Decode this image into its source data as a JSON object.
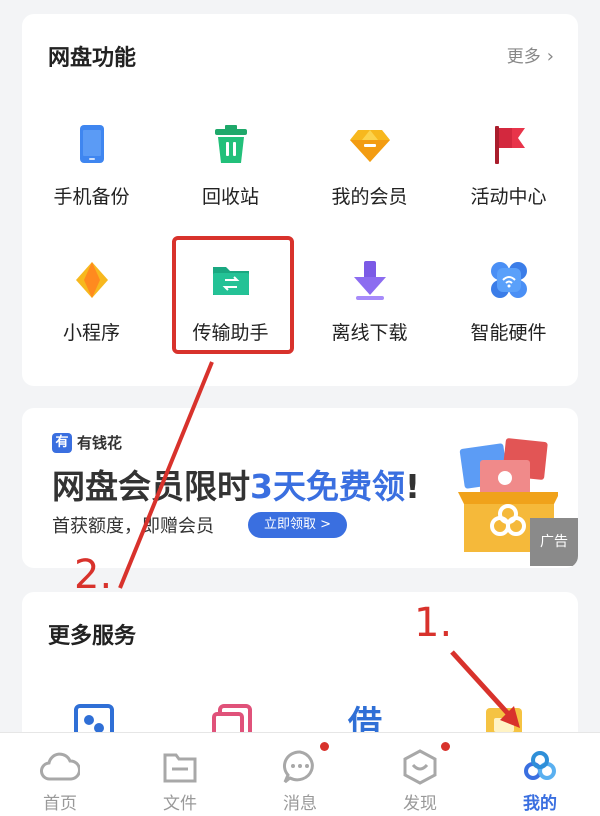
{
  "features": {
    "title": "网盘功能",
    "more": "更多",
    "items": [
      {
        "label": "手机备份",
        "icon": "phone-icon"
      },
      {
        "label": "回收站",
        "icon": "trash-icon"
      },
      {
        "label": "我的会员",
        "icon": "gem-icon"
      },
      {
        "label": "活动中心",
        "icon": "flag-icon"
      },
      {
        "label": "小程序",
        "icon": "mini-program-icon"
      },
      {
        "label": "传输助手",
        "icon": "transfer-folder-icon"
      },
      {
        "label": "离线下载",
        "icon": "download-icon"
      },
      {
        "label": "智能硬件",
        "icon": "smart-device-icon"
      }
    ]
  },
  "ad": {
    "brand_mark": "有",
    "brand": "有钱花",
    "title_main": "网盘会员限时",
    "title_accent": "3天免费领",
    "title_end": "!",
    "subtitle": "首获额度，即赠会员",
    "button": "立即领取 >",
    "tag": "广告"
  },
  "services": {
    "title": "更多服务",
    "partial_text": "借"
  },
  "tabs": [
    {
      "label": "首页",
      "icon": "cloud-icon"
    },
    {
      "label": "文件",
      "icon": "folder-icon"
    },
    {
      "label": "消息",
      "icon": "chat-icon"
    },
    {
      "label": "发现",
      "icon": "discover-icon"
    },
    {
      "label": "我的",
      "icon": "profile-logo-icon",
      "active": true
    }
  ],
  "annotations": {
    "step1": "1.",
    "step2": "2."
  },
  "colors": {
    "accent": "#3a6fe0",
    "annotation": "#d8322c"
  }
}
